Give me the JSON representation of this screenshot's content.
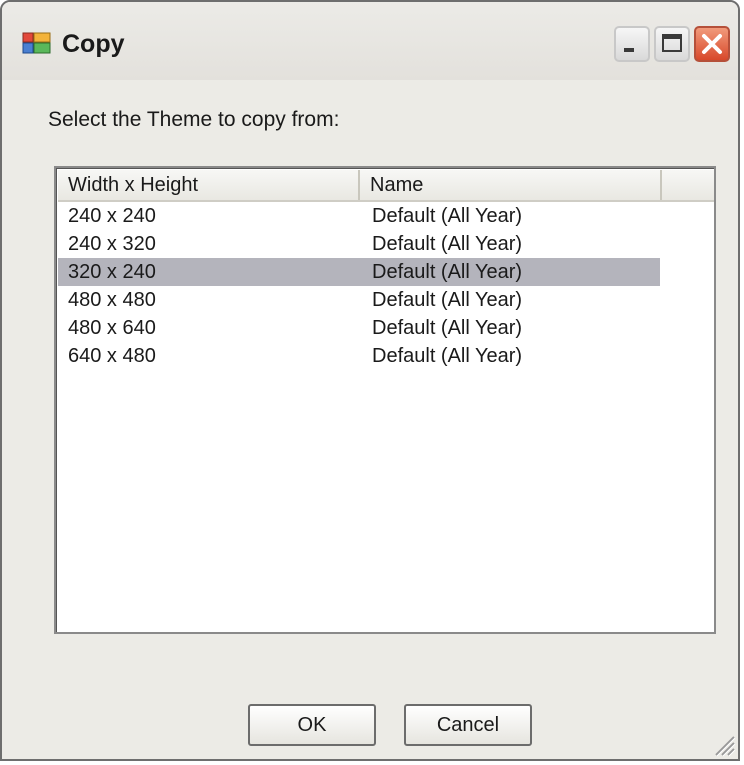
{
  "window": {
    "title": "Copy"
  },
  "dialog": {
    "prompt": "Select the Theme to copy from:"
  },
  "list": {
    "columns": [
      "Width x Height",
      "Name",
      ""
    ],
    "rows": [
      {
        "size": "240 x 240",
        "name": "Default (All Year)",
        "selected": false
      },
      {
        "size": "240 x 320",
        "name": "Default (All Year)",
        "selected": false
      },
      {
        "size": "320 x 240",
        "name": "Default (All Year)",
        "selected": true
      },
      {
        "size": "480 x 480",
        "name": "Default (All Year)",
        "selected": false
      },
      {
        "size": "480 x 640",
        "name": "Default (All Year)",
        "selected": false
      },
      {
        "size": "640 x 480",
        "name": "Default (All Year)",
        "selected": false
      }
    ]
  },
  "buttons": {
    "ok": "OK",
    "cancel": "Cancel"
  },
  "colors": {
    "selection": "#b4b4bc",
    "close_button": "#d8482a",
    "dialog_background": "#ecebe6"
  },
  "icons": {
    "title": "application-window-icon",
    "minimize": "minimize-icon",
    "maximize": "maximize-icon",
    "close": "close-icon",
    "resize": "resize-grip-icon"
  }
}
